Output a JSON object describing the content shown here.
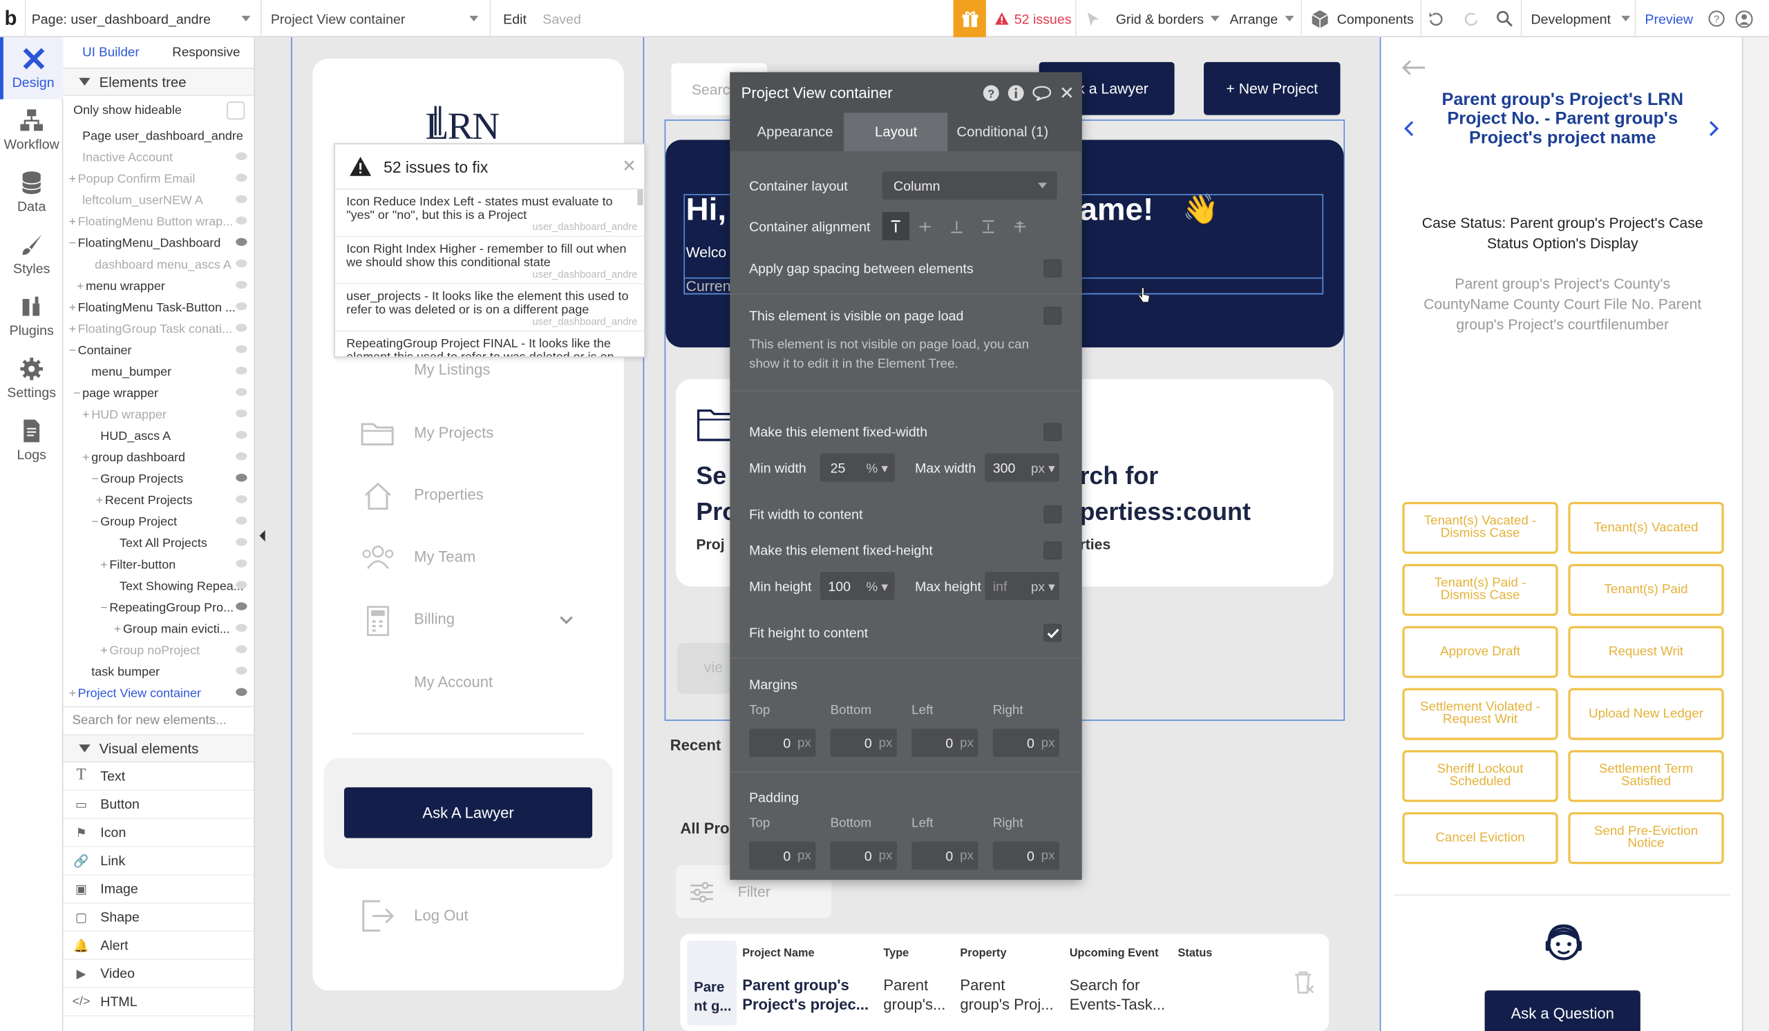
{
  "topbar": {
    "page_label": "Page: user_dashboard_andre",
    "element_select": "Project View container",
    "edit": "Edit",
    "saved": "Saved",
    "issues": "52 issues",
    "grid": "Grid & borders",
    "arrange": "Arrange",
    "components": "Components",
    "branch": "Development",
    "preview": "Preview"
  },
  "rail": {
    "design": "Design",
    "workflow": "Workflow",
    "data": "Data",
    "styles": "Styles",
    "plugins": "Plugins",
    "settings": "Settings",
    "logs": "Logs"
  },
  "tree": {
    "tab_builder": "UI Builder",
    "tab_responsive": "Responsive",
    "section_title": "Elements tree",
    "only_hideable": "Only show hideable",
    "rows": [
      {
        "text": "Page user_dashboard_andre",
        "pm": "",
        "grey": false,
        "eye": false
      },
      {
        "text": "Inactive Account",
        "pm": "",
        "grey": true,
        "eye": true
      },
      {
        "text": "Popup Confirm Email",
        "pm": "+",
        "grey": true,
        "eye": true
      },
      {
        "text": "leftcolum_userNEW A",
        "pm": "",
        "grey": true,
        "eye": true
      },
      {
        "text": "FloatingMenu Button wrap...",
        "pm": "+",
        "grey": true,
        "eye": true
      },
      {
        "text": "FloatingMenu_Dashboard",
        "pm": "−",
        "grey": false,
        "eye": true,
        "on": true
      },
      {
        "text": "dashboard menu_ascs A",
        "pm": "",
        "grey": true,
        "eye": true
      },
      {
        "text": "menu wrapper",
        "pm": "+",
        "grey": false,
        "eye": true
      },
      {
        "text": "FloatingMenu Task-Button ...",
        "pm": "+",
        "grey": false,
        "eye": true
      },
      {
        "text": "FloatingGroup Task conati...",
        "pm": "+",
        "grey": true,
        "eye": true
      },
      {
        "text": "Container",
        "pm": "−",
        "grey": false,
        "eye": true
      },
      {
        "text": "menu_bumper",
        "pm": "",
        "grey": false,
        "eye": true
      },
      {
        "text": "page wrapper",
        "pm": "−",
        "grey": false,
        "eye": true
      },
      {
        "text": "HUD wrapper",
        "pm": "+",
        "grey": true,
        "eye": true
      },
      {
        "text": "HUD_ascs A",
        "pm": "",
        "grey": false,
        "eye": true
      },
      {
        "text": "group dashboard",
        "pm": "+",
        "grey": false,
        "eye": true
      },
      {
        "text": "Group Projects",
        "pm": "−",
        "grey": false,
        "eye": true,
        "on": true
      },
      {
        "text": "Recent Projects",
        "pm": "+",
        "grey": false,
        "eye": true
      },
      {
        "text": "Group Project",
        "pm": "−",
        "grey": false,
        "eye": true
      },
      {
        "text": "Text All Projects",
        "pm": "",
        "grey": false,
        "eye": true
      },
      {
        "text": "Filter-button",
        "pm": "+",
        "grey": false,
        "eye": true
      },
      {
        "text": "Text Showing Repea...",
        "pm": "",
        "grey": false,
        "eye": true
      },
      {
        "text": "RepeatingGroup Pro...",
        "pm": "−",
        "grey": false,
        "eye": true,
        "on": true
      },
      {
        "text": "Group main evicti...",
        "pm": "+",
        "grey": false,
        "eye": true
      },
      {
        "text": "Group noProject",
        "pm": "+",
        "grey": true,
        "eye": true
      },
      {
        "text": "task bumper",
        "pm": "",
        "grey": false,
        "eye": true
      },
      {
        "text": "Project View container",
        "pm": "+",
        "grey": false,
        "eye": true,
        "on": true,
        "selected": true
      }
    ],
    "search_placeholder": "Search for new elements...",
    "visual_title": "Visual elements",
    "visual": [
      "Text",
      "Button",
      "Icon",
      "Link",
      "Image",
      "Shape",
      "Alert",
      "Video",
      "HTML"
    ]
  },
  "left_canvas": {
    "logo": "LRN",
    "nav": [
      "My Listings",
      "My Projects",
      "Properties",
      "My Team",
      "Billing",
      "My Account"
    ],
    "ask_lawyer": "Ask A Lawyer",
    "logout": "Log Out"
  },
  "issues_panel": {
    "title": "52 issues to fix",
    "items": [
      {
        "text": "Icon Reduce Index Left - states must evaluate to \"yes\" or \"no\", but this is a Project",
        "page": "user_dashboard_andre"
      },
      {
        "text": "Icon Right Index Higher - remember to fill out when we should show this conditional state",
        "page": "user_dashboard_andre"
      },
      {
        "text": "user_projects - It looks like the element this used to refer to was deleted or is on a different page",
        "page": "user_dashboard_andre"
      },
      {
        "text": "RepeatingGroup Project FINAL - It looks like the element this used to refer to was deleted or is on",
        "page": ""
      }
    ]
  },
  "main_canvas": {
    "search_placeholder": "Searc",
    "ask_lawyer": "k a Lawyer",
    "new_project": "+ New Project",
    "hero_hi": "Hi,",
    "hero_name": "ame!",
    "hero_welcome": "Welco",
    "hero_current": "Curren",
    "card_left_title_1": "Se",
    "card_left_title_2": "Pro",
    "card_left_sub": "Proj",
    "card_right_title_1": "rch for",
    "card_right_title_2": "pertiess:count",
    "card_right_sub": "rties",
    "view_btn": "vie",
    "recent": "Recent",
    "all_projects": "All Pro",
    "filter": "Filter",
    "table": {
      "headers": [
        "Project Name",
        "Type",
        "Property",
        "Upcoming Event",
        "Status"
      ],
      "thumb": "Pare\nnt g...",
      "row": [
        "Parent group's\nProject's projec...",
        "Parent\ngroup's...",
        "Parent\ngroup's Proj...",
        "Search for\nEvents-Task..."
      ]
    }
  },
  "editor": {
    "title": "Project View container",
    "tabs": [
      "Appearance",
      "Layout",
      "Conditional (1)"
    ],
    "container_layout_label": "Container layout",
    "container_layout_value": "Column",
    "alignment_label": "Container alignment",
    "gap_label": "Apply gap spacing between elements",
    "visible_label": "This element is visible on page load",
    "visible_note": "This element is not visible on page load, you can show it to edit it in the Element Tree.",
    "fixed_width_label": "Make this element fixed-width",
    "min_width_label": "Min width",
    "min_width_value": "25",
    "min_width_unit": "%",
    "max_width_label": "Max width",
    "max_width_value": "300",
    "max_width_unit": "px",
    "fit_width_label": "Fit width to content",
    "fixed_height_label": "Make this element fixed-height",
    "min_height_label": "Min height",
    "min_height_value": "100",
    "min_height_unit": "%",
    "max_height_label": "Max height",
    "max_height_value": "inf",
    "max_height_unit": "px",
    "fit_height_label": "Fit height to content",
    "margins_label": "Margins",
    "padding_label": "Padding",
    "sides": [
      "Top",
      "Bottom",
      "Left",
      "Right"
    ],
    "zero": "0",
    "px": "px"
  },
  "right_canvas": {
    "title": "Parent group's Project's LRN Project No. - Parent group's Project's project name",
    "case_status": "Case Status: Parent group's Project's Case Status Option's Display",
    "county": "Parent group's Project's County's CountyName County Court File No. Parent group's Project's courtfilenumber",
    "buttons": [
      "Tenant(s) Vacated - Dismiss Case",
      "Tenant(s) Vacated",
      "Tenant(s) Paid - Dismiss Case",
      "Tenant(s) Paid",
      "Approve Draft",
      "Request Writ",
      "Settlement Violated - Request Writ",
      "Upload New Ledger",
      "Sheriff Lockout Scheduled",
      "Settlement Term Satisfied",
      "Cancel Eviction",
      "Send Pre-Eviction Notice"
    ],
    "ask_question": "Ask a Question"
  },
  "colors": {
    "navy": "#131f4a",
    "accent_blue": "#2b56d8",
    "gold": "#f0c24b",
    "issues_red": "#e2384d",
    "gift_orange": "#f2a11f"
  }
}
